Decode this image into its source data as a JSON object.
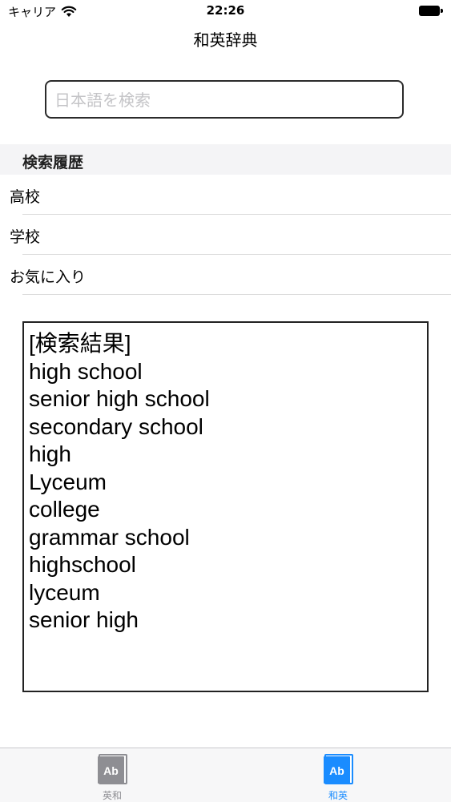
{
  "status": {
    "carrier": "キャリア",
    "time": "22:26"
  },
  "nav": {
    "title": "和英辞典"
  },
  "search": {
    "placeholder": "日本語を検索",
    "value": ""
  },
  "history": {
    "header": "検索履歴",
    "items": [
      {
        "label": "高校"
      },
      {
        "label": "学校"
      },
      {
        "label": "お気に入り"
      }
    ]
  },
  "results": {
    "lines": [
      "[検索結果]",
      "high school",
      "senior high school",
      "secondary school",
      "high",
      "Lyceum",
      "college",
      "grammar school",
      "highschool",
      "lyceum",
      "senior high"
    ]
  },
  "tabs": [
    {
      "label": "英和",
      "icon": "dictionary-book-icon",
      "icon_text": "Ab",
      "selected": false,
      "color": "#8e8e93"
    },
    {
      "label": "和英",
      "icon": "dictionary-book-icon",
      "icon_text": "Ab",
      "selected": true,
      "color": "#1a8cff"
    }
  ]
}
